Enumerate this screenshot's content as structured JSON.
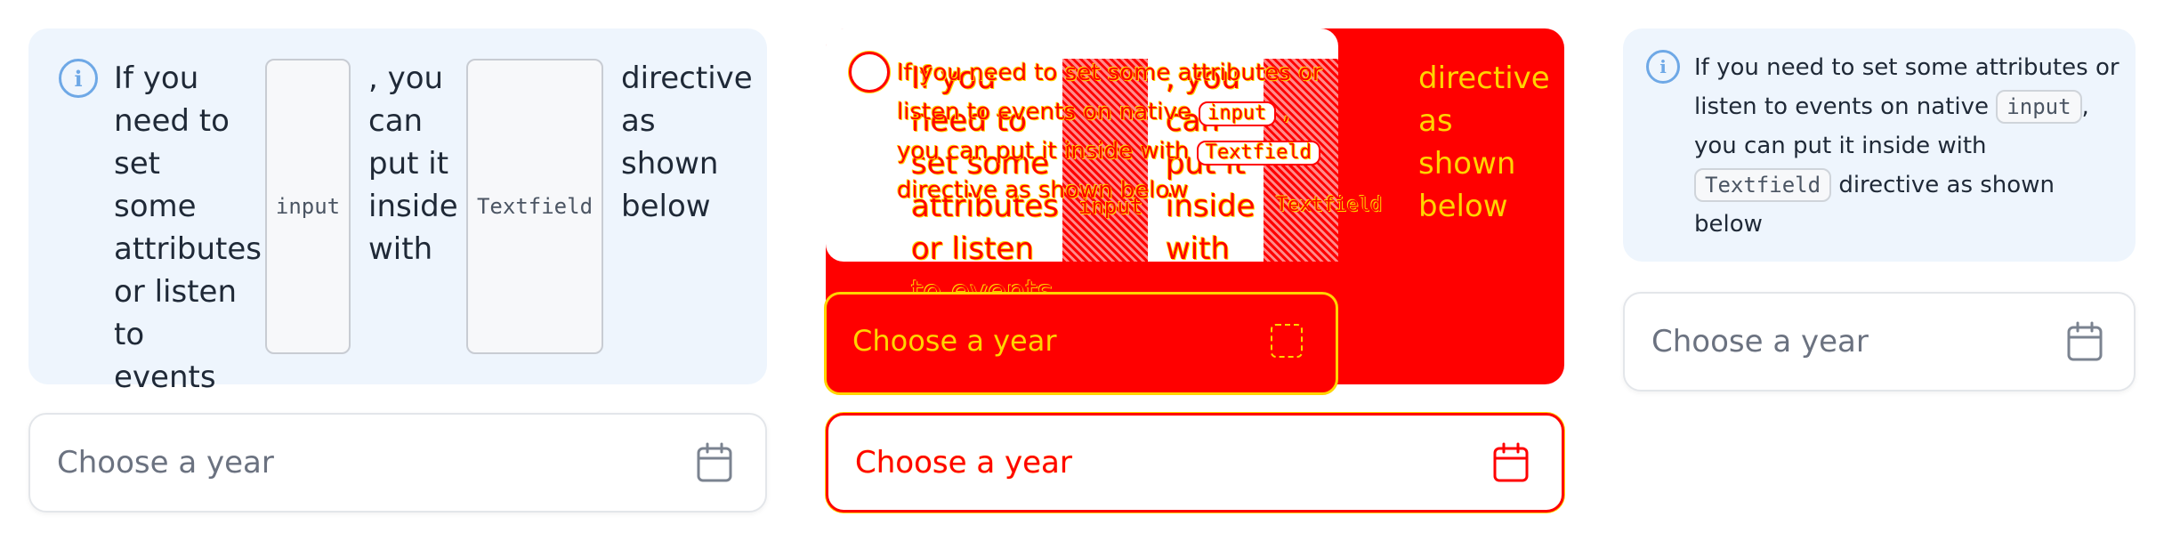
{
  "notice": {
    "words_col1": [
      "If you",
      "need to",
      "set some",
      "attributes",
      "or listen",
      "to events",
      "on native"
    ],
    "code1": "input",
    "words_col2": [
      ", you",
      "can",
      "put it",
      "inside",
      "with"
    ],
    "code2": "Textfield",
    "words_col3": [
      "directive",
      "as",
      "shown",
      "below"
    ],
    "text_before_input": "If you need to set some attributes or listen to events on native",
    "text_after_input": ",",
    "text_before_textfield": "you can put it inside with",
    "text_after_textfield": "directive as shown below"
  },
  "datepicker": {
    "placeholder": "Choose a year",
    "icon": "calendar-icon"
  },
  "icons": {
    "info": "i"
  },
  "colors": {
    "info_bg": "#eef5fd",
    "info_icon": "#6ea8e6",
    "overlay_red": "#ff0000",
    "overlay_yellow": "#ffd400"
  }
}
